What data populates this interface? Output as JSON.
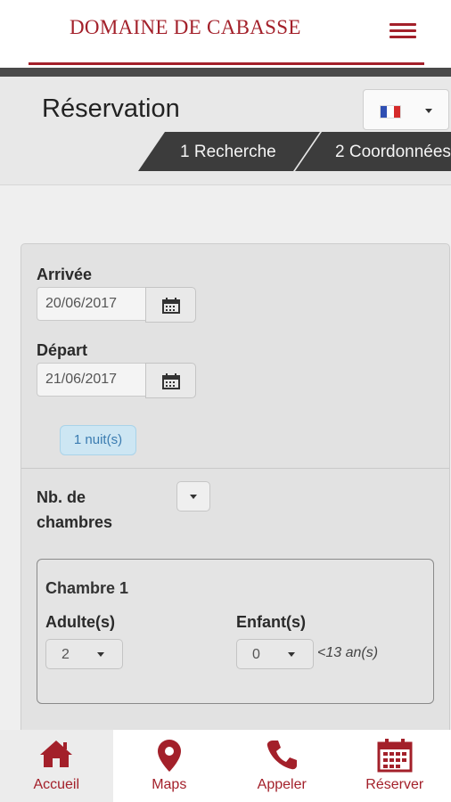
{
  "header": {
    "brand": "DOMAINE DE CABASSE",
    "menu_icon": "hamburger-menu-icon"
  },
  "reservation": {
    "title": "Réservation",
    "language_flag": "flag-france-icon",
    "steps": [
      {
        "label": "1 Recherche"
      },
      {
        "label": "2 Coordonnées"
      }
    ]
  },
  "form": {
    "arrival": {
      "label": "Arrivée",
      "value": "20/06/2017"
    },
    "departure": {
      "label": "Départ",
      "value": "21/06/2017"
    },
    "nights_badge": "1 nuit(s)",
    "rooms": {
      "label_line1": "Nb. de",
      "label_line2": "chambres",
      "value": ""
    },
    "room_card": {
      "title": "Chambre 1",
      "adults": {
        "label": "Adulte(s)",
        "value": "2"
      },
      "children": {
        "label": "Enfant(s)",
        "value": "0",
        "note": "<13 an(s)"
      }
    }
  },
  "bottom_nav": [
    {
      "label": "Accueil",
      "icon": "home-icon",
      "active": true
    },
    {
      "label": "Maps",
      "icon": "map-pin-icon",
      "active": false
    },
    {
      "label": "Appeler",
      "icon": "phone-icon",
      "active": false
    },
    {
      "label": "Réserver",
      "icon": "calendar-icon",
      "active": false
    }
  ],
  "colors": {
    "brand": "#a3202a",
    "step_bg": "#3c3c3c",
    "badge_bg": "#cde6f3",
    "badge_text": "#3a7bb0"
  }
}
